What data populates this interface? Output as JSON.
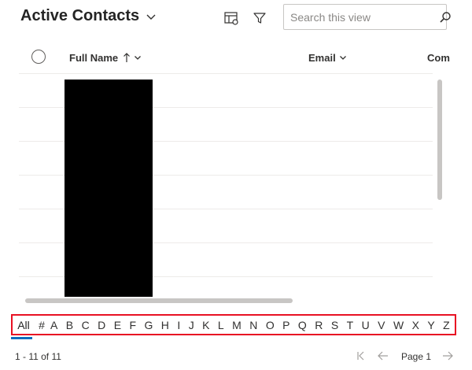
{
  "header": {
    "title": "Active Contacts",
    "search_placeholder": "Search this view"
  },
  "columns": [
    {
      "label": "Full Name",
      "sort": "ascending"
    },
    {
      "label": "Email"
    },
    {
      "label": "Com"
    }
  ],
  "jumpbar": {
    "all_label": "All",
    "hash_label": "#",
    "letters": [
      "A",
      "B",
      "C",
      "D",
      "E",
      "F",
      "G",
      "H",
      "I",
      "J",
      "K",
      "L",
      "M",
      "N",
      "O",
      "P",
      "Q",
      "R",
      "S",
      "T",
      "U",
      "V",
      "W",
      "X",
      "Y",
      "Z"
    ],
    "selected": "All"
  },
  "footer": {
    "record_count": "1 - 11 of 11",
    "page_label": "Page 1"
  },
  "colors": {
    "accent": "#0f6cbd",
    "highlight_border": "#e81123"
  }
}
